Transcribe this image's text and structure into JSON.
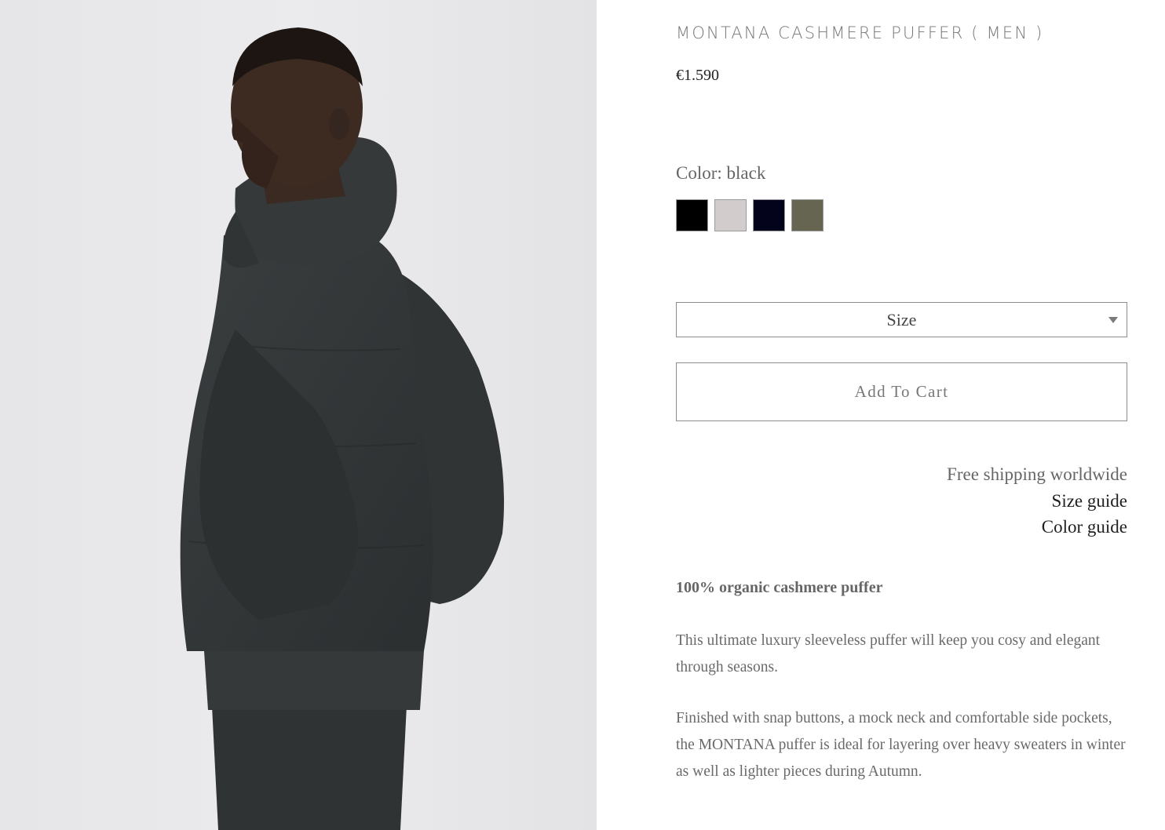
{
  "product": {
    "title": "MONTANA CASHMERE PUFFER ( MEN )",
    "price": "€1.590",
    "color_label": "Color: black",
    "swatches": [
      {
        "name": "black",
        "hex": "#000000"
      },
      {
        "name": "light grey",
        "hex": "#d2cccc"
      },
      {
        "name": "navy",
        "hex": "#03041c"
      },
      {
        "name": "olive",
        "hex": "#666552"
      }
    ],
    "size_label": "Size",
    "add_to_cart": "Add To Cart",
    "free_shipping": "Free shipping worldwide",
    "size_guide": "Size guide",
    "color_guide": "Color guide",
    "description": {
      "heading": "100% organic cashmere puffer",
      "p1": "This ultimate luxury sleeveless puffer will keep you cosy and elegant through seasons.",
      "p2": "Finished with snap buttons, a mock neck and comfortable side pockets, the MONTANA puffer is ideal for layering over heavy sweaters in winter as well as lighter pieces during Autumn."
    }
  },
  "photo": {
    "subject": "model wearing charcoal cashmere puffer vest and scarf"
  }
}
